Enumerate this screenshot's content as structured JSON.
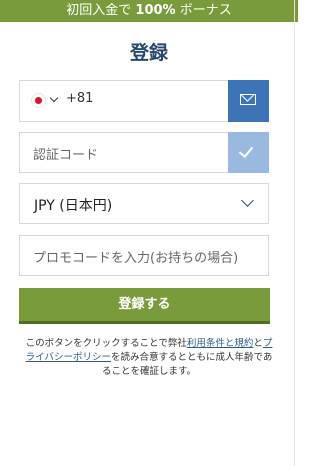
{
  "banner": {
    "text_before": "初回入金で ",
    "text_bold": "100%",
    "text_after": " ボーナス"
  },
  "form": {
    "title": "登録",
    "phone": {
      "country_icon": "japan-flag-icon",
      "dial_code": "+81",
      "send_button_icon": "mail-icon"
    },
    "verification": {
      "placeholder": "認証コード",
      "verify_button_icon": "check-icon"
    },
    "currency": {
      "selected": "JPY (日本円)"
    },
    "promo": {
      "placeholder": "プロモコードを入力(お持ちの場合)"
    },
    "submit_label": "登録する",
    "disclaimer": {
      "part1": "このボタンをクリックすることで弊社",
      "link1": "利用条件と規約",
      "part2": "と",
      "link2": "プライバシーポリシー",
      "part3": "を読み合意するとともに成人年齢であることを確証します。"
    }
  },
  "colors": {
    "brand_green": "#7a9b3c",
    "primary_blue": "#3c74b6",
    "light_blue": "#9ab9df",
    "title_navy": "#254a6e"
  }
}
